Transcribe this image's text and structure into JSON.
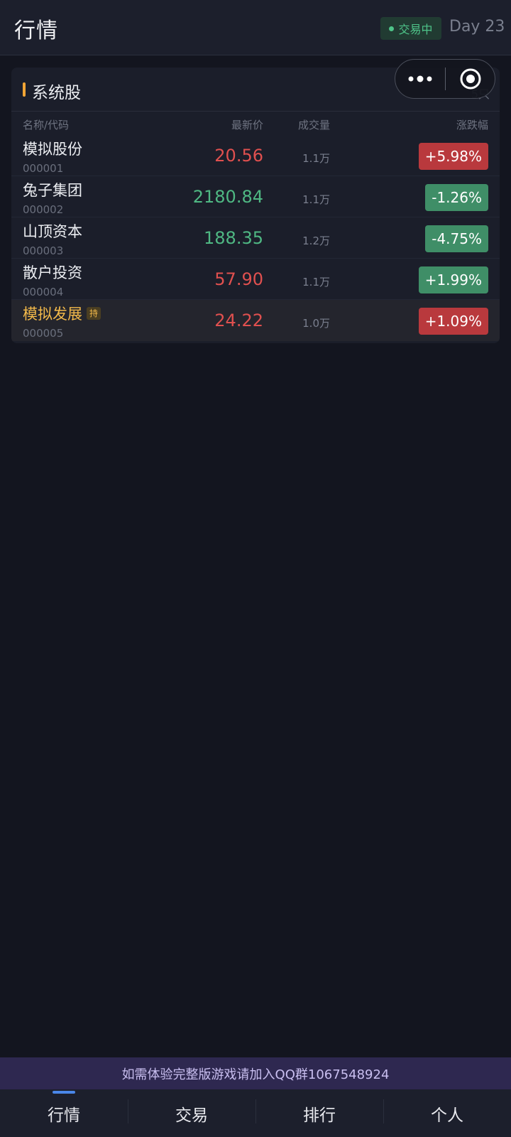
{
  "header": {
    "title": "行情",
    "status_text": "交易中",
    "day_label": "Day 23"
  },
  "card": {
    "title": "系统股",
    "count_label": "5只",
    "columns": {
      "name": "名称/代码",
      "price": "最新价",
      "volume": "成交量",
      "change": "涨跌幅"
    },
    "stocks": [
      {
        "name": "模拟股份",
        "code": "000001",
        "price": "20.56",
        "price_dir": "up",
        "volume": "1.1万",
        "change": "+5.98%",
        "change_dir": "up",
        "held": false
      },
      {
        "name": "兔子集团",
        "code": "000002",
        "price": "2180.84",
        "price_dir": "down",
        "volume": "1.1万",
        "change": "-1.26%",
        "change_dir": "down",
        "held": false
      },
      {
        "name": "山顶资本",
        "code": "000003",
        "price": "188.35",
        "price_dir": "down",
        "volume": "1.2万",
        "change": "-4.75%",
        "change_dir": "down",
        "held": false
      },
      {
        "name": "散户投资",
        "code": "000004",
        "price": "57.90",
        "price_dir": "up",
        "volume": "1.1万",
        "change": "+1.99%",
        "change_dir": "down",
        "held": false
      },
      {
        "name": "模拟发展",
        "code": "000005",
        "price": "24.22",
        "price_dir": "up",
        "volume": "1.0万",
        "change": "+1.09%",
        "change_dir": "up",
        "held": true,
        "held_label": "持"
      }
    ]
  },
  "notice": "如需体验完整版游戏请加入QQ群1067548924",
  "tabs": [
    {
      "label": "行情",
      "active": true
    },
    {
      "label": "交易",
      "active": false
    },
    {
      "label": "排行",
      "active": false
    },
    {
      "label": "个人",
      "active": false
    }
  ],
  "colors": {
    "up": "#e0504f",
    "down": "#4fb883",
    "accent": "#f2a535",
    "held": "#f2b94a",
    "tab_indicator": "#4a86e8"
  }
}
